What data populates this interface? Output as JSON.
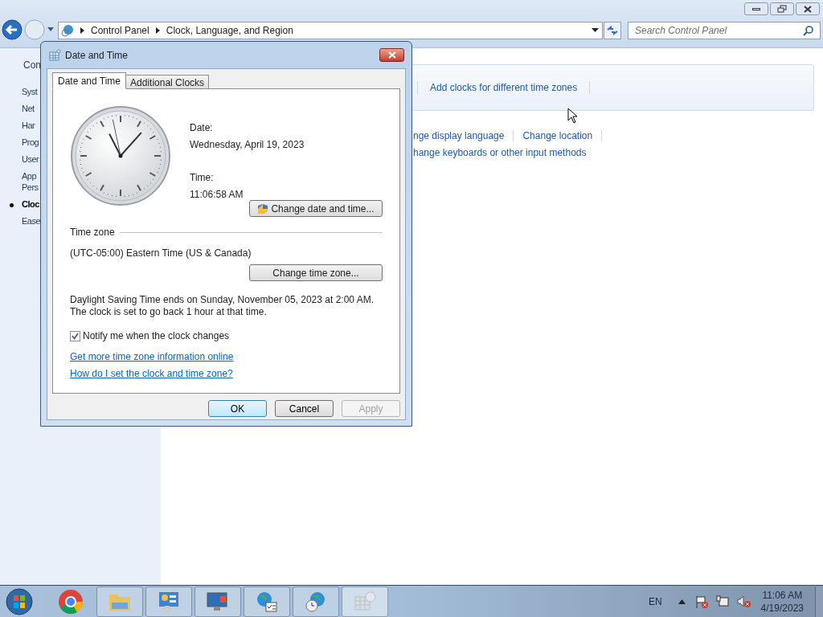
{
  "address_bar": {
    "crumbs": [
      "Control Panel",
      "Clock, Language, and Region"
    ]
  },
  "search": {
    "placeholder": "Search Control Panel"
  },
  "sidebar": {
    "heading": "Con",
    "items": [
      {
        "label": "Syst",
        "selected": false
      },
      {
        "label": "Net",
        "selected": false
      },
      {
        "label": "Har",
        "selected": false
      },
      {
        "label": "Prog",
        "selected": false
      },
      {
        "label": "User",
        "selected": false
      },
      {
        "label": "App\nPers",
        "selected": false
      },
      {
        "label": "Cloc",
        "selected": true
      },
      {
        "label": "Ease",
        "selected": false
      }
    ]
  },
  "content": {
    "panel_links": [
      "Add clocks for different time zones"
    ],
    "region_links": [
      [
        "nge display language",
        "Change location"
      ],
      [
        "hange keyboards or other input methods"
      ]
    ]
  },
  "dialog": {
    "title": "Date and Time",
    "tabs": [
      {
        "label": "Date and Time",
        "selected": true
      },
      {
        "label": "Additional Clocks",
        "selected": false
      }
    ],
    "date_label": "Date:",
    "date": "Wednesday, April 19, 2023",
    "time_label": "Time:",
    "time": "11:06:58 AM",
    "change_datetime_button": "Change date and time...",
    "timezone_heading": "Time zone",
    "timezone": "(UTC-05:00) Eastern Time (US & Canada)",
    "change_timezone_button": "Change time zone...",
    "dst_note": "Daylight Saving Time ends on Sunday, November 05, 2023 at 2:00 AM. The clock is set to go back 1 hour at that time.",
    "notify": {
      "label": "Notify me when the clock changes",
      "checked": true
    },
    "links": [
      "Get more time zone information online",
      "How do I set the clock and time zone?"
    ],
    "buttons": [
      {
        "label": "OK",
        "default": true,
        "disabled": false
      },
      {
        "label": "Cancel",
        "default": false,
        "disabled": false
      },
      {
        "label": "Apply",
        "default": false,
        "disabled": true
      }
    ]
  },
  "taskbar": {
    "language": "EN",
    "time": "11:06 AM",
    "date": "4/19/2023"
  }
}
